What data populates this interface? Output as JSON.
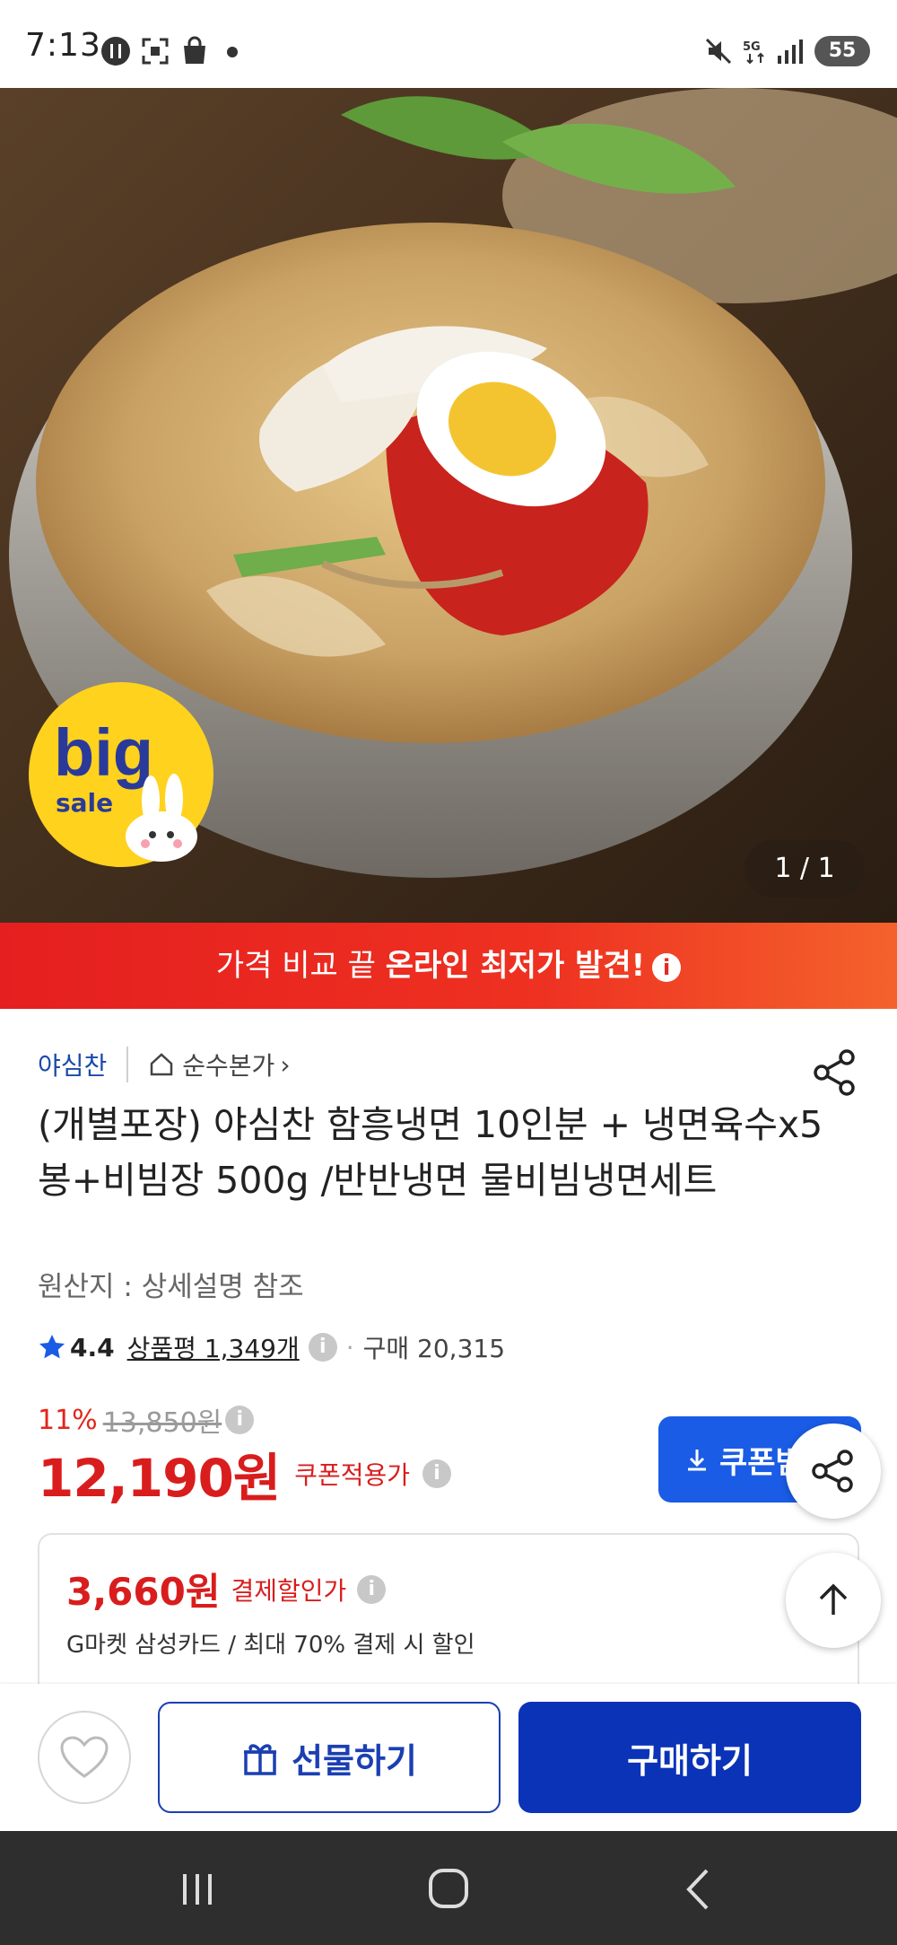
{
  "status_bar": {
    "time": "7:13",
    "battery": "55"
  },
  "product_image": {
    "counter": "1 / 1",
    "badge_big": "big",
    "badge_sale": "sale"
  },
  "promo_banner": {
    "prefix": "가격 비교 끝 ",
    "highlight": "온라인 최저가 발견!",
    "info": "i"
  },
  "seller": {
    "name": "야심찬",
    "store_label": "순수본가",
    "store_chevron": "›"
  },
  "product": {
    "title": "(개별포장) 야심찬 함흥냉면 10인분 + 냉면육수x5봉+비빔장 500g /반반냉면 물비빔냉면세트",
    "origin": "원산지 : 상세설명 참조",
    "rating": "4.4",
    "reviews": "상품평 1,349개",
    "purchases": "구매 20,315",
    "discount_pct": "11%",
    "original_price": "13,850원",
    "price": "12,190원",
    "price_label": "쿠폰적용가",
    "coupon_button": "쿠폰받"
  },
  "payment_card": {
    "amount": "3,660원",
    "label": "결제할인가",
    "description": "G마켓 삼성카드 / 최대 70% 결제 시 할인"
  },
  "bottom_bar": {
    "gift_label": "선물하기",
    "buy_label": "구매하기"
  },
  "colors": {
    "brand_blue": "#0a33b8",
    "price_red": "#d91d1d",
    "banner_red": "#e51f1f"
  }
}
